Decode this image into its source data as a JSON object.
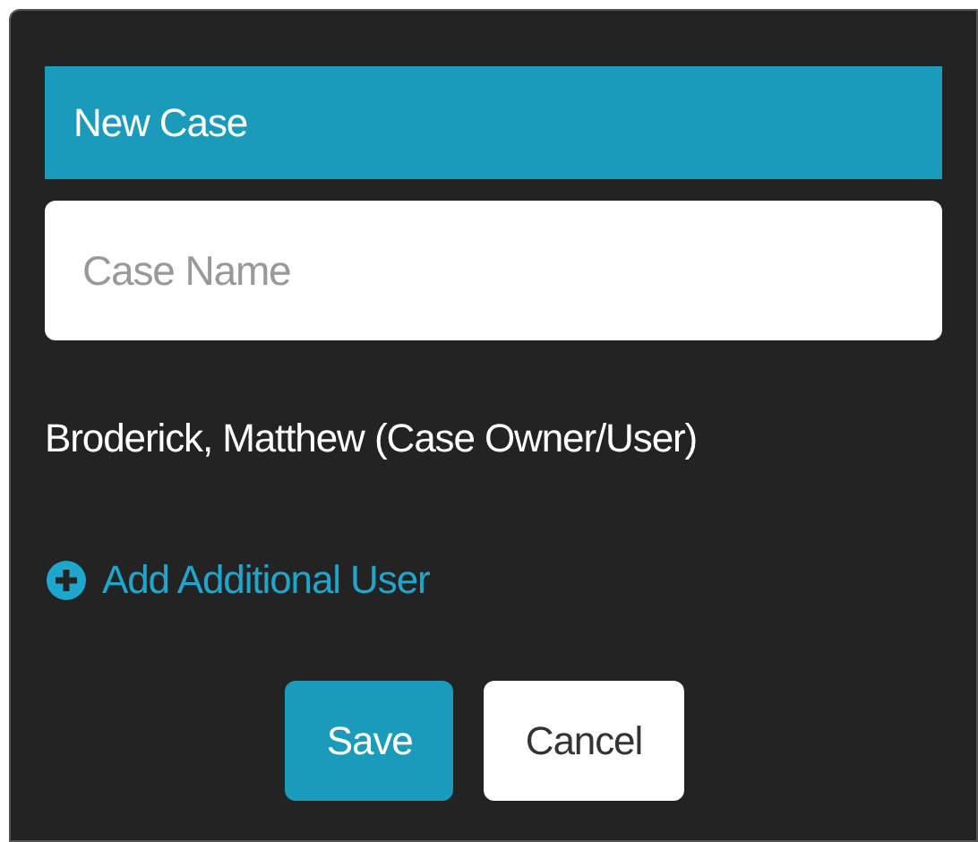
{
  "dialog": {
    "title": "New Case",
    "case_name_field": {
      "placeholder": "Case Name"
    },
    "users": [
      "Broderick, Matthew (Case Owner/User)"
    ],
    "add_user_link": {
      "label": "Add Additional User"
    },
    "buttons": [
      {
        "label": "Save",
        "kind": "primary"
      },
      {
        "label": "Cancel",
        "kind": "secondary"
      }
    ]
  }
}
